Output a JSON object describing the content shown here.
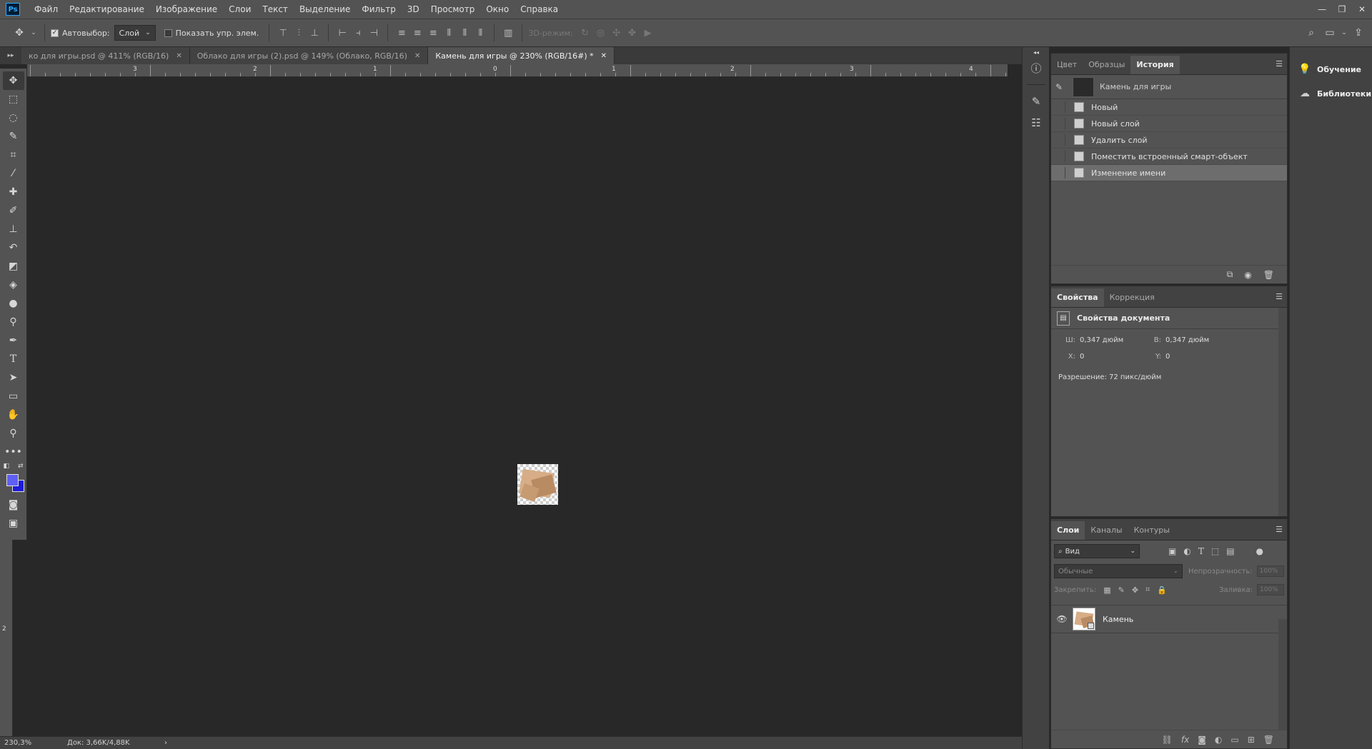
{
  "app": {
    "logo": "Ps"
  },
  "menu": [
    "Файл",
    "Редактирование",
    "Изображение",
    "Слои",
    "Текст",
    "Выделение",
    "Фильтр",
    "3D",
    "Просмотр",
    "Окно",
    "Справка"
  ],
  "window_controls": [
    "—",
    "❐",
    "✕"
  ],
  "options": {
    "autoselect_label": "Автовыбор:",
    "autoselect_checked": true,
    "autoselect_value": "Слой",
    "show_controls_label": "Показать упр. элем.",
    "show_controls_checked": false,
    "mode3d_label": "3D-режим:"
  },
  "tabs": [
    {
      "label": "ко для игры.psd @ 411% (RGB/16)",
      "active": false
    },
    {
      "label": "Облако для игры (2).psd @ 149% (Облако, RGB/16)",
      "active": false
    },
    {
      "label": "Камень для игры @ 230% (RGB/16#) *",
      "active": true
    }
  ],
  "ruler": {
    "top_labels": [
      "3",
      "2",
      "1",
      "0",
      "1",
      "2",
      "3",
      "4"
    ],
    "left_labels": [
      "2"
    ]
  },
  "status": {
    "zoom": "230,3%",
    "doc": "Док: 3,66K/4,88K"
  },
  "right_strip": {
    "learn": "Обучение",
    "libraries": "Библиотеки"
  },
  "history_panel": {
    "tabs": [
      "Цвет",
      "Образцы",
      "История"
    ],
    "active_tab": "История",
    "snapshot_name": "Камень для игры",
    "items": [
      "Новый",
      "Новый слой",
      "Удалить слой",
      "Поместить встроенный смарт-объект",
      "Изменение имени"
    ],
    "selected_index": 4
  },
  "properties_panel": {
    "tabs": [
      "Свойства",
      "Коррекция"
    ],
    "active_tab": "Свойства",
    "heading": "Свойства документа",
    "width_label": "Ш:",
    "width_value": "0,347 дюйм",
    "height_label": "В:",
    "height_value": "0,347 дюйм",
    "x_label": "X:",
    "x_value": "0",
    "y_label": "Y:",
    "y_value": "0",
    "resolution": "Разрешение: 72 пикс/дюйм"
  },
  "layers_panel": {
    "tabs": [
      "Слои",
      "Каналы",
      "Контуры"
    ],
    "active_tab": "Слои",
    "filter_value": "Вид",
    "blend_mode": "Обычные",
    "opacity_label": "Непрозрачность:",
    "opacity_value": "100%",
    "lock_label": "Закрепить:",
    "fill_label": "Заливка:",
    "fill_value": "100%",
    "layers": [
      {
        "name": "Камень",
        "visible": true
      }
    ]
  },
  "colors": {
    "foreground": "#5f5ff5",
    "background": "#1c1cd8",
    "accent": "#31a8ff"
  }
}
